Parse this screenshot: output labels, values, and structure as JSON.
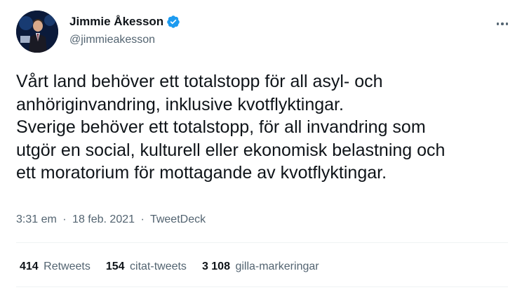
{
  "author": {
    "display_name": "Jimmie Åkesson",
    "handle": "@jimmieakesson",
    "verified_icon": "verified-badge-icon",
    "avatar_icon": "avatar-photo"
  },
  "menu": {
    "more_icon": "more-options-icon"
  },
  "tweet": {
    "lines": [
      "Vårt land behöver ett totalstopp för all asyl- och",
      "anhöriginvandring, inklusive kvotflyktingar.",
      "Sverige behöver ett totalstopp, för all invandring som",
      "utgör en social, kulturell eller ekonomisk belastning och",
      "ett moratorium för mottagande av kvotflyktingar."
    ],
    "time": "3:31 em",
    "date": "18 feb. 2021",
    "source": "TweetDeck",
    "separator": "·"
  },
  "stats": {
    "retweets": {
      "count": "414",
      "label": "Retweets"
    },
    "quotes": {
      "count": "154",
      "label": "citat-tweets"
    },
    "likes": {
      "count": "3 108",
      "label": "gilla-markeringar"
    }
  },
  "colors": {
    "text": "#0f1419",
    "secondary": "#536471",
    "verified": "#1d9bf0",
    "divider": "#eff3f4"
  }
}
